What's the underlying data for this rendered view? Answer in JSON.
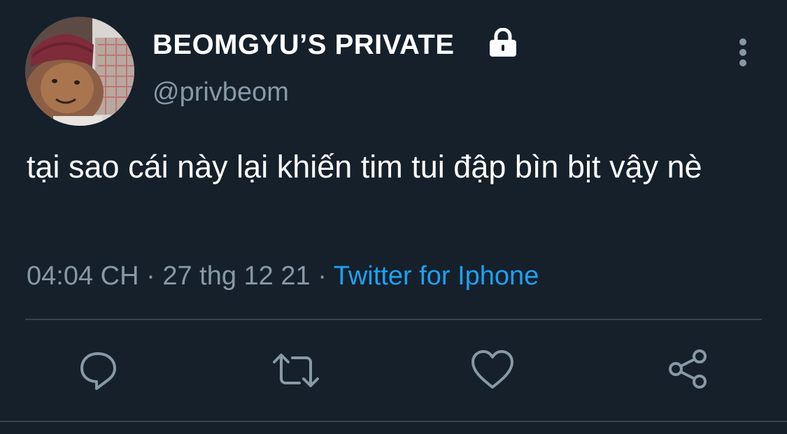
{
  "author": {
    "display_name": "BEOMGYU’S PRIVATE",
    "handle": "@privbeom",
    "protected_icon": "lock-icon",
    "avatar": "profile-photo"
  },
  "tweet": {
    "text": "tại sao cái này lại khiến tim tui đập bìn bịt vậy nè",
    "time": "04:04 CH",
    "date": "27 thg 12 21",
    "separator": "·",
    "source": "Twitter for Iphone"
  },
  "actions": [
    {
      "icon": "reply-icon"
    },
    {
      "icon": "retweet-icon"
    },
    {
      "icon": "like-icon"
    },
    {
      "icon": "share-icon"
    }
  ],
  "menu_icon": "more-vertical-icon",
  "colors": {
    "background": "#15202b",
    "text": "#ffffff",
    "secondary": "#8899a6",
    "link": "#1da1f2",
    "divider": "#38444d"
  }
}
